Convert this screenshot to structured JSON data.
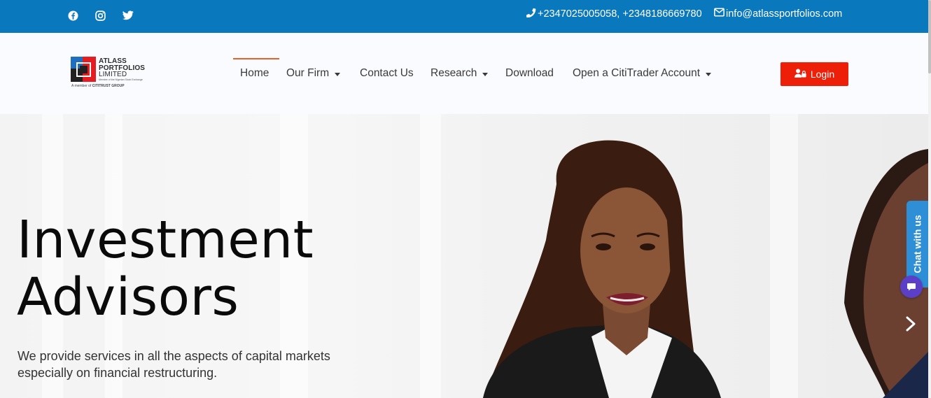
{
  "topbar": {
    "social_icons": [
      "facebook-icon",
      "instagram-icon",
      "twitter-icon"
    ],
    "phone_icon": "phone-icon",
    "phone": "+2347025005058, +2348186669780",
    "email_icon": "envelope-icon",
    "email": "info@atlassportfolios.com",
    "background_color": "#0a78bd"
  },
  "header": {
    "logo": {
      "line1": "ATLASS",
      "line2": "PORTFOLIOS",
      "line3": "LIMITED",
      "tagline": "Member of the Nigerian Stock Exchange",
      "member_prefix": "A member of",
      "member_group": "CITITRUST GROUP"
    },
    "nav": [
      {
        "label": "Home",
        "active": true,
        "dropdown": false
      },
      {
        "label": "Our Firm",
        "active": false,
        "dropdown": true
      },
      {
        "label": "Contact Us",
        "active": false,
        "dropdown": false
      },
      {
        "label": "Research",
        "active": false,
        "dropdown": true
      },
      {
        "label": "Download",
        "active": false,
        "dropdown": false
      },
      {
        "label": "Open a CitiTrader Account",
        "active": false,
        "dropdown": true
      }
    ],
    "login_label": "Login",
    "login_icon": "user-lock-icon",
    "active_accent": "#e7622a",
    "login_color": "#ee1f09"
  },
  "hero": {
    "title_line1": "Investment",
    "title_line2": "Advisors",
    "subtitle_line1": "We provide services in all the aspects of capital markets",
    "subtitle_line2": "especially on financial restructuring.",
    "next_icon": "chevron-right-icon"
  },
  "chat": {
    "tab_label": "Chat with us",
    "bubble_icon": "chat-bubble-icon",
    "tab_color": "#2e8fd6",
    "bubble_color": "#5b3fc6"
  }
}
